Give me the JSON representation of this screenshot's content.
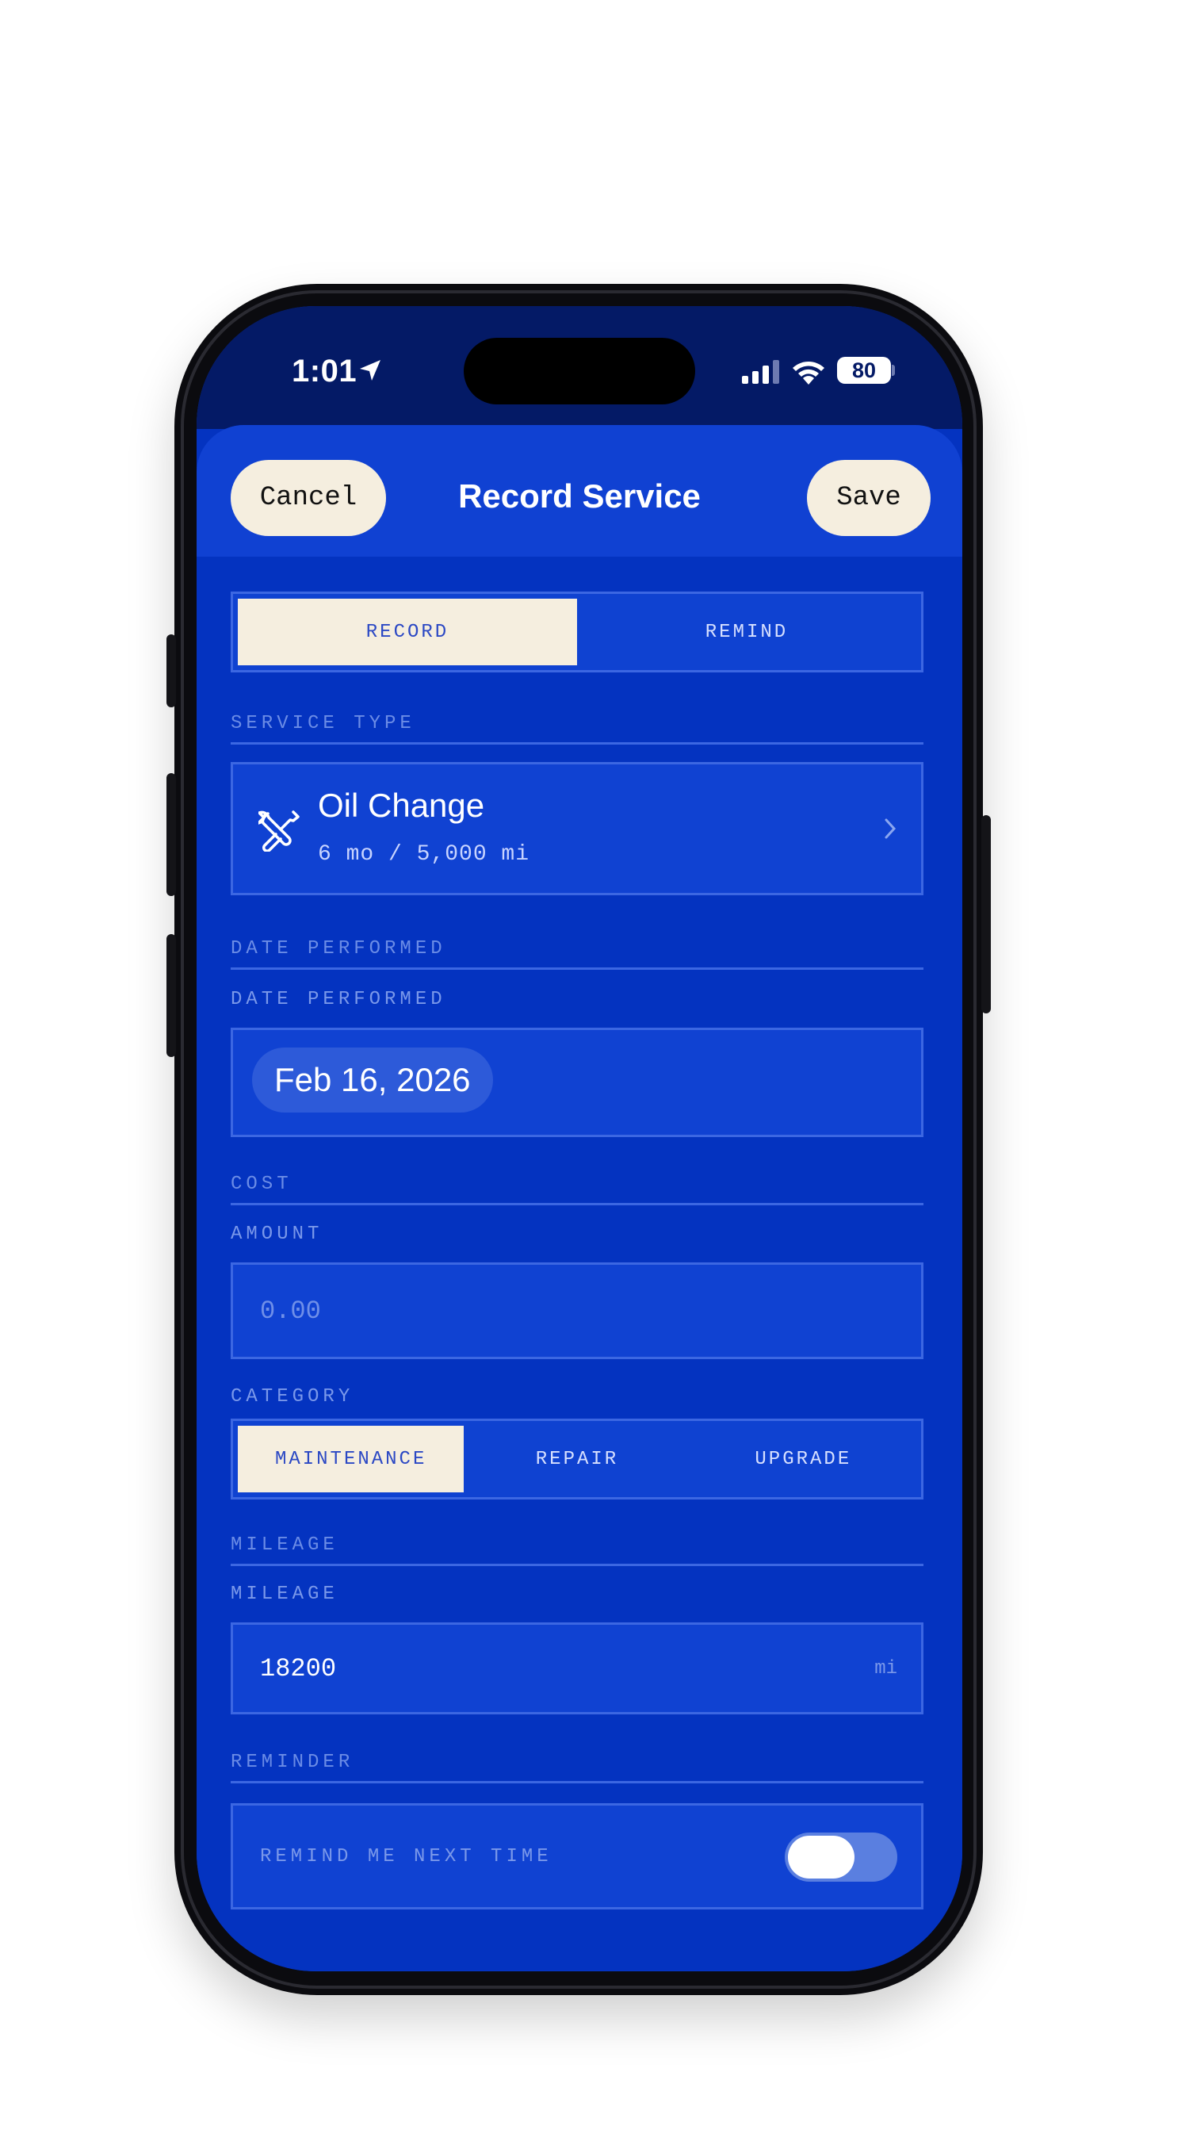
{
  "status_bar": {
    "time": "1:01",
    "battery": "80"
  },
  "nav": {
    "cancel_label": "Cancel",
    "title": "Record Service",
    "save_label": "Save"
  },
  "mode_tabs": [
    {
      "label": "RECORD",
      "active": true
    },
    {
      "label": "REMIND",
      "active": false
    }
  ],
  "service_type": {
    "header": "SERVICE TYPE",
    "name": "Oil Change",
    "interval": "6 mo / 5,000 mi",
    "icon": "wrench-screwdriver-icon"
  },
  "date_section": {
    "header": "DATE PERFORMED",
    "label": "DATE PERFORMED",
    "value": "Feb 16, 2026"
  },
  "cost_section": {
    "header": "COST",
    "amount_label": "AMOUNT",
    "amount_placeholder": "0.00",
    "category_label": "CATEGORY",
    "categories": [
      {
        "label": "MAINTENANCE",
        "active": true
      },
      {
        "label": "REPAIR",
        "active": false
      },
      {
        "label": "UPGRADE",
        "active": false
      }
    ]
  },
  "mileage_section": {
    "header": "MILEAGE",
    "label": "MILEAGE",
    "value": "18200",
    "unit": "mi"
  },
  "reminder_section": {
    "header": "REMINDER",
    "toggle_label": "REMIND ME NEXT TIME",
    "toggle_on": false
  },
  "colors": {
    "screen_bg": "#0433c0",
    "status_bar_bg": "#041a66",
    "cream": "#f5eedf",
    "field_bg": "#1042d2",
    "border": "#3c67e2"
  }
}
